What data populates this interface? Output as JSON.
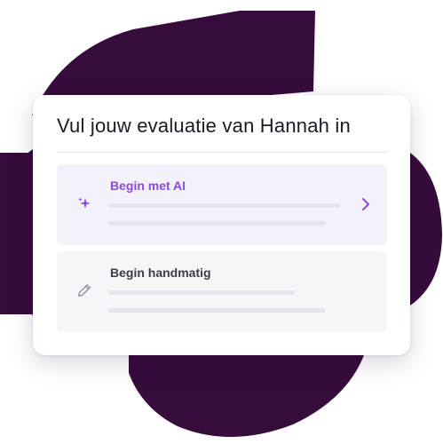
{
  "card": {
    "title": "Vul jouw evaluatie van Hannah in"
  },
  "options": [
    {
      "label": "Begin met AI",
      "icon": "sparkle-icon",
      "accent": "#8a49e0"
    },
    {
      "label": "Begin handmatig",
      "icon": "pencil-icon"
    }
  ],
  "colors": {
    "backdrop": "#360c3a",
    "accent": "#8a49e0"
  }
}
